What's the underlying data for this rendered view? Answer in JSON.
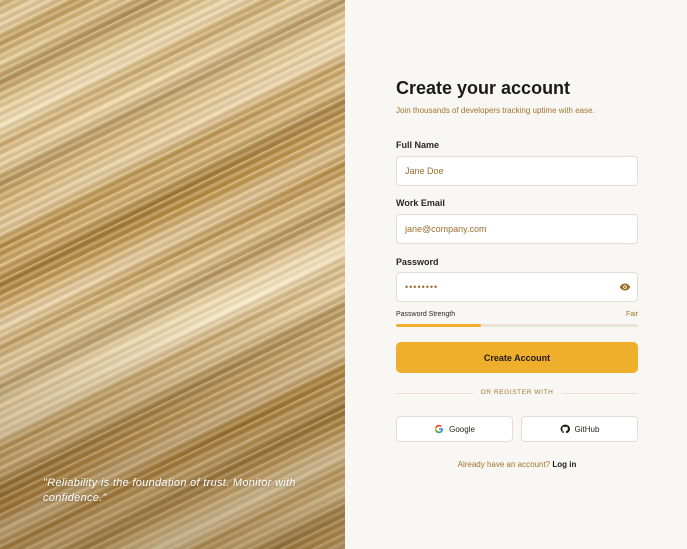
{
  "hero": {
    "image": "golden-silk-abstract",
    "quote": "\"Reliability is the foundation of trust. Monitor with confidence.\""
  },
  "form": {
    "title": "Create your account",
    "subtitle": "Join thousands of developers tracking uptime with ease.",
    "full_name": {
      "label": "Full Name",
      "placeholder": "Jane Doe"
    },
    "work_email": {
      "label": "Work Email",
      "placeholder": "jane@company.com"
    },
    "password": {
      "label": "Password",
      "value": "••••••••",
      "toggle_icon": "eye-icon"
    },
    "strength": {
      "label": "Password Strength",
      "value": "Fair",
      "level": 0.35
    },
    "submit_label": "Create Account",
    "divider_text": "OR REGISTER WITH",
    "social": [
      {
        "label": "Google",
        "icon": "google-icon"
      },
      {
        "label": "GitHub",
        "icon": "github-icon"
      }
    ],
    "login_prompt": "Already have an account?",
    "login_link": "Log in"
  },
  "colors": {
    "accent": "#efae2b",
    "accent_text": "#a2752e",
    "background": "#f9f7f4"
  }
}
